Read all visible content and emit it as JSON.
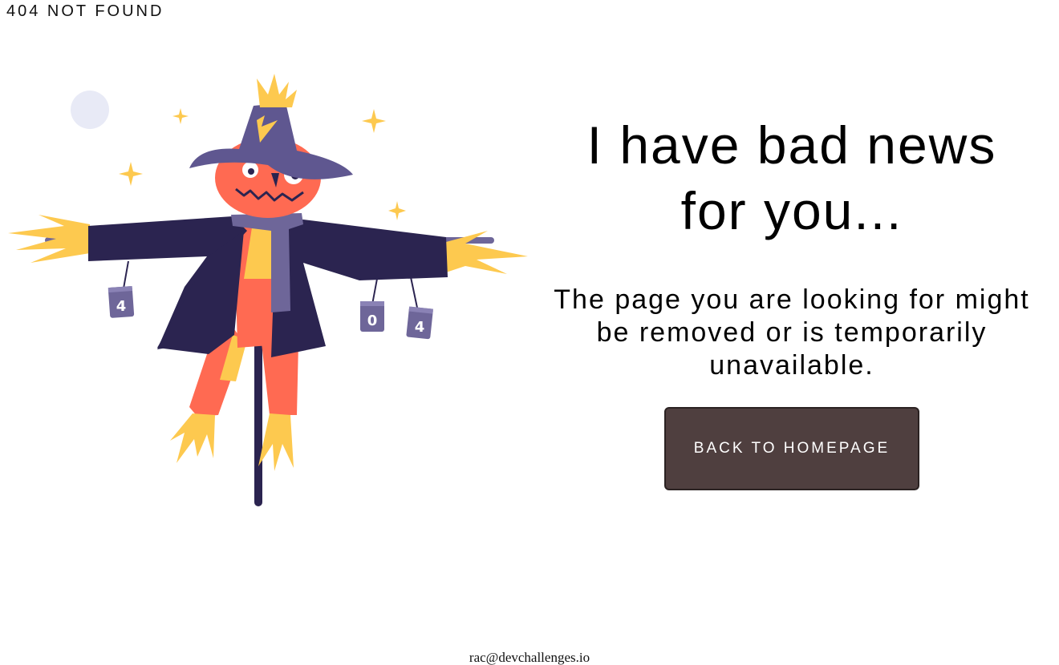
{
  "header": {
    "brand": "404 NOT FOUND"
  },
  "illustration": {
    "can_labels": [
      "4",
      "0",
      "4"
    ],
    "colors": {
      "hat": "#5f5790",
      "coat": "#2b2450",
      "face": "#ff6a52",
      "straw": "#fdc94f",
      "scarf": "#6e6699",
      "moon": "#e8eaf6"
    }
  },
  "main": {
    "headline_line1": "I have bad news",
    "headline_line2": "for you...",
    "subtext_line1": "The page you are looking for might",
    "subtext_line2": "be removed or is temporarily",
    "subtext_line3": "unavailable.",
    "button_label": "BACK TO HOMEPAGE",
    "button_color": "#4f3f3f"
  },
  "footer": {
    "text": "rac@devchallenges.io"
  }
}
